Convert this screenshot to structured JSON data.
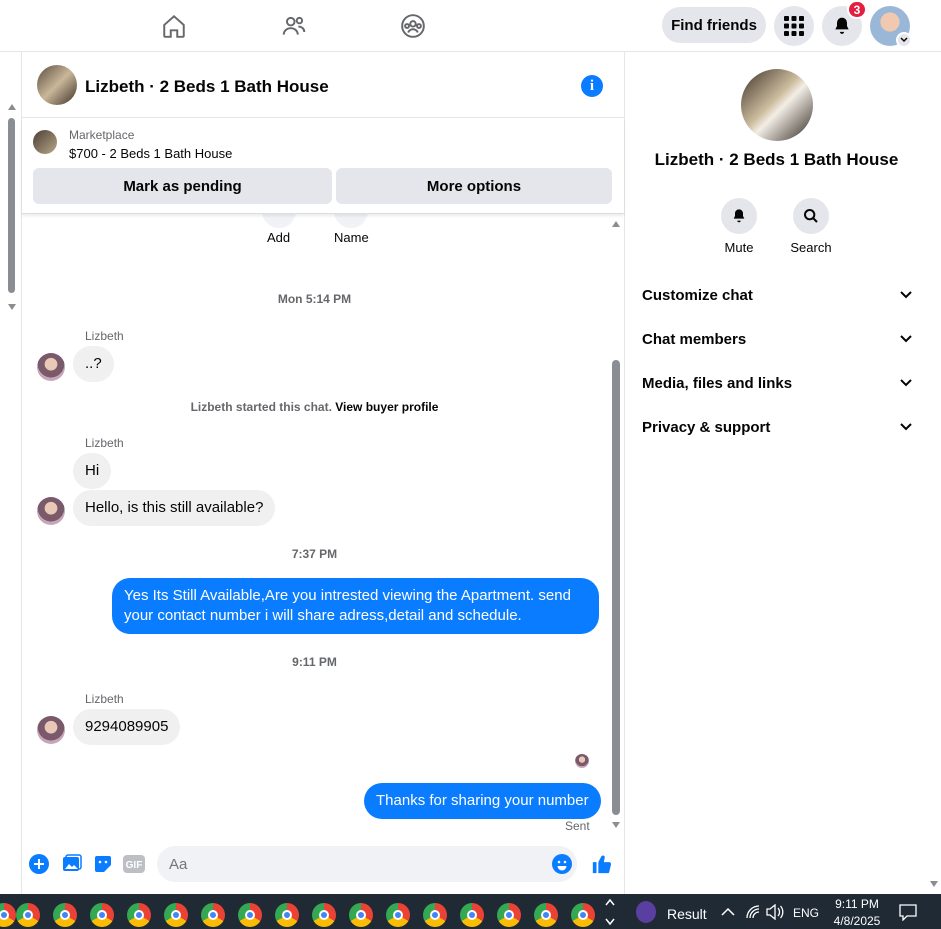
{
  "nav": {
    "find_friends": "Find friends",
    "notification_count": "3"
  },
  "thread": {
    "title": "Lizbeth · 2 Beds 1 Bath House"
  },
  "marketplace": {
    "label": "Marketplace",
    "item": "$700 - 2 Beds 1 Bath House",
    "mark_pending": "Mark as pending",
    "more_options": "More options"
  },
  "chips": {
    "add": "Add",
    "name": "Name"
  },
  "messages": {
    "stamp1": "Mon 5:14 PM",
    "sender1": "Lizbeth",
    "msg1": "..?",
    "system_text": "Lizbeth started this chat.",
    "system_link": "View buyer profile",
    "sender2": "Lizbeth",
    "msg2": "Hi",
    "msg3": "Hello, is this still available?",
    "stamp2": "7:37 PM",
    "out1": "Yes Its Still Available,Are you intrested viewing the Apartment. send your contact number i will share adress,detail and schedule.",
    "stamp3": "9:11 PM",
    "sender3": "Lizbeth",
    "msg4": "9294089905",
    "out2": "Thanks for sharing your number",
    "status": "Sent"
  },
  "composer": {
    "placeholder": "Aa"
  },
  "right_panel": {
    "title": "Lizbeth · 2 Beds 1 Bath House",
    "mute": "Mute",
    "search": "Search",
    "sections": [
      "Customize chat",
      "Chat members",
      "Media, files and links",
      "Privacy & support"
    ]
  },
  "taskbar": {
    "result": "Result",
    "lang": "ENG",
    "time": "9:11 PM",
    "date": "4/8/2025"
  },
  "colors": {
    "accent": "#0a7cff",
    "badge": "#e41e3f",
    "bubble_in": "#f0f0f0"
  }
}
